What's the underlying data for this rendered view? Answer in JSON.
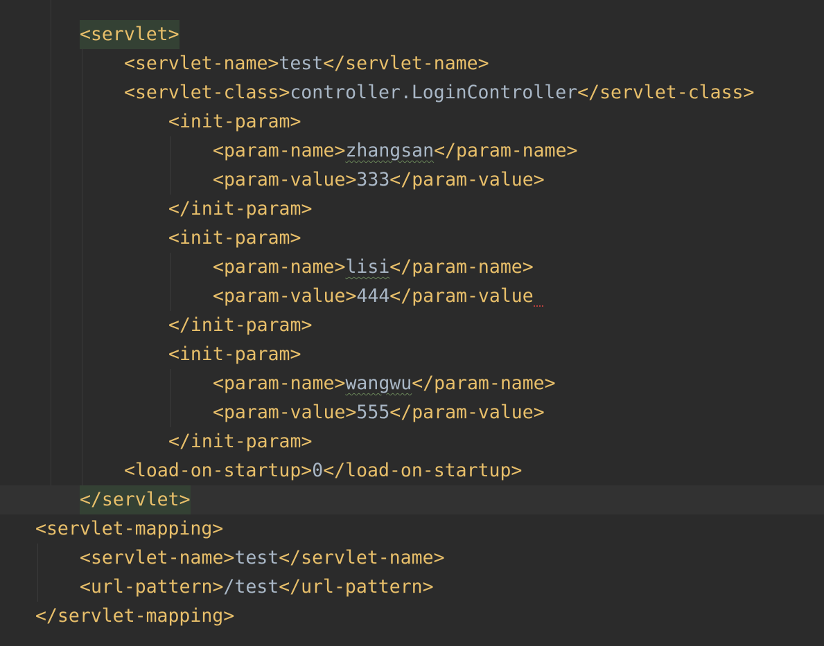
{
  "editor": {
    "lines": [
      {
        "indent": 1,
        "parts": [
          {
            "t": "tag",
            "v": "<servlet>",
            "hl": true
          }
        ]
      },
      {
        "indent": 2,
        "parts": [
          {
            "t": "tag",
            "v": "<servlet-name>"
          },
          {
            "t": "txt",
            "v": "test"
          },
          {
            "t": "tag",
            "v": "</servlet-name>"
          }
        ]
      },
      {
        "indent": 2,
        "parts": [
          {
            "t": "tag",
            "v": "<servlet-class>"
          },
          {
            "t": "txt",
            "v": "controller.LoginController"
          },
          {
            "t": "tag",
            "v": "</servlet-class>"
          }
        ]
      },
      {
        "indent": 3,
        "parts": [
          {
            "t": "tag",
            "v": "<init-param>"
          }
        ]
      },
      {
        "indent": 4,
        "parts": [
          {
            "t": "tag",
            "v": "<param-name>"
          },
          {
            "t": "txt",
            "v": "zhangsan",
            "typo": true
          },
          {
            "t": "tag",
            "v": "</param-name>"
          }
        ]
      },
      {
        "indent": 4,
        "parts": [
          {
            "t": "tag",
            "v": "<param-value>"
          },
          {
            "t": "num",
            "v": "333"
          },
          {
            "t": "tag",
            "v": "</param-value>"
          }
        ]
      },
      {
        "indent": 3,
        "parts": [
          {
            "t": "tag",
            "v": "</init-param>"
          }
        ]
      },
      {
        "indent": 3,
        "parts": [
          {
            "t": "tag",
            "v": "<init-param>"
          }
        ]
      },
      {
        "indent": 4,
        "parts": [
          {
            "t": "tag",
            "v": "<param-name>"
          },
          {
            "t": "txt",
            "v": "lisi",
            "typo": true
          },
          {
            "t": "tag",
            "v": "</param-name>"
          }
        ]
      },
      {
        "indent": 4,
        "parts": [
          {
            "t": "tag",
            "v": "<param-value>"
          },
          {
            "t": "num",
            "v": "444"
          },
          {
            "t": "tag",
            "v": "</param-value"
          }
        ],
        "error": true
      },
      {
        "indent": 3,
        "parts": [
          {
            "t": "tag",
            "v": "</init-param>"
          }
        ]
      },
      {
        "indent": 3,
        "parts": [
          {
            "t": "tag",
            "v": "<init-param>"
          }
        ]
      },
      {
        "indent": 4,
        "parts": [
          {
            "t": "tag",
            "v": "<param-name>"
          },
          {
            "t": "txt",
            "v": "wangwu",
            "typo": true
          },
          {
            "t": "tag",
            "v": "</param-name>"
          }
        ]
      },
      {
        "indent": 4,
        "parts": [
          {
            "t": "tag",
            "v": "<param-value>"
          },
          {
            "t": "num",
            "v": "555"
          },
          {
            "t": "tag",
            "v": "</param-value>"
          }
        ]
      },
      {
        "indent": 3,
        "parts": [
          {
            "t": "tag",
            "v": "</init-param>"
          }
        ]
      },
      {
        "indent": 2,
        "parts": [
          {
            "t": "tag",
            "v": "<load-on-startup>"
          },
          {
            "t": "num",
            "v": "0"
          },
          {
            "t": "tag",
            "v": "</load-on-startup>"
          }
        ]
      },
      {
        "indent": 1,
        "parts": [
          {
            "t": "tag",
            "v": "</servlet>",
            "hl": true
          }
        ],
        "current": true
      },
      {
        "indent": 0,
        "parts": [
          {
            "t": "tag",
            "v": "<servlet-mapping>"
          }
        ]
      },
      {
        "indent": 1,
        "parts": [
          {
            "t": "tag",
            "v": "<servlet-name>"
          },
          {
            "t": "txt",
            "v": "test"
          },
          {
            "t": "tag",
            "v": "</servlet-name>"
          }
        ]
      },
      {
        "indent": 1,
        "parts": [
          {
            "t": "tag",
            "v": "<url-pattern>"
          },
          {
            "t": "txt",
            "v": "/test"
          },
          {
            "t": "tag",
            "v": "</url-pattern>"
          }
        ]
      },
      {
        "indent": 0,
        "parts": [
          {
            "t": "tag",
            "v": "</servlet-mapping>"
          }
        ]
      }
    ]
  },
  "colors": {
    "background": "#2b2b2b",
    "current_line": "#323232",
    "tag": "#e8bf6a",
    "text": "#a9b7c6",
    "tag_match_highlight": "#344134",
    "typo_underline": "#6a8759",
    "error_underline": "#bc3f3c"
  }
}
